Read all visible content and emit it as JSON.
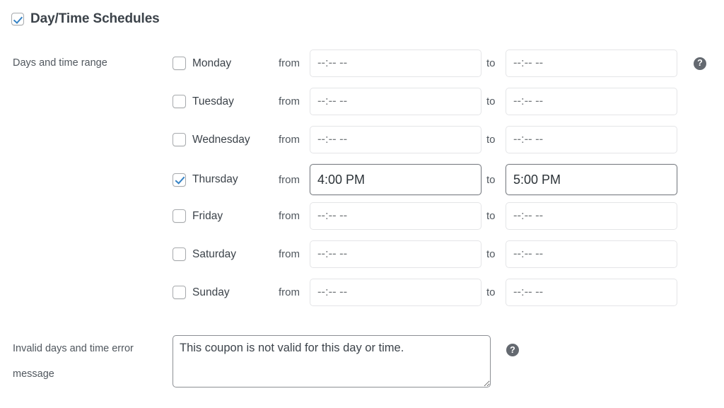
{
  "section": {
    "enabled": true,
    "title": "Day/Time Schedules",
    "checkbox_name": "day-time-schedules-toggle"
  },
  "days_field": {
    "label": "Days and time range",
    "from_label": "from",
    "to_label": "to",
    "time_placeholder": "--:-- --",
    "help_icon": "question-mark-icon",
    "rows": [
      {
        "day": "Monday",
        "checked": false,
        "from": "",
        "to": ""
      },
      {
        "day": "Tuesday",
        "checked": false,
        "from": "",
        "to": ""
      },
      {
        "day": "Wednesday",
        "checked": false,
        "from": "",
        "to": ""
      },
      {
        "day": "Thursday",
        "checked": true,
        "from": "4:00 PM",
        "to": "5:00 PM"
      },
      {
        "day": "Friday",
        "checked": false,
        "from": "",
        "to": ""
      },
      {
        "day": "Saturday",
        "checked": false,
        "from": "",
        "to": ""
      },
      {
        "day": "Sunday",
        "checked": false,
        "from": "",
        "to": ""
      }
    ]
  },
  "error_message_field": {
    "label_line1": "Invalid days and time error",
    "label_line2": "message",
    "value": "This coupon is not valid for this day or time.",
    "help_icon": "question-mark-icon"
  },
  "colors": {
    "accent_checkbox": "#3582c4",
    "text_primary": "#3c434a",
    "text_secondary": "#50575e",
    "border_idle": "#e4e5e7",
    "border_active": "#7c8085",
    "help_bg": "#646970"
  }
}
